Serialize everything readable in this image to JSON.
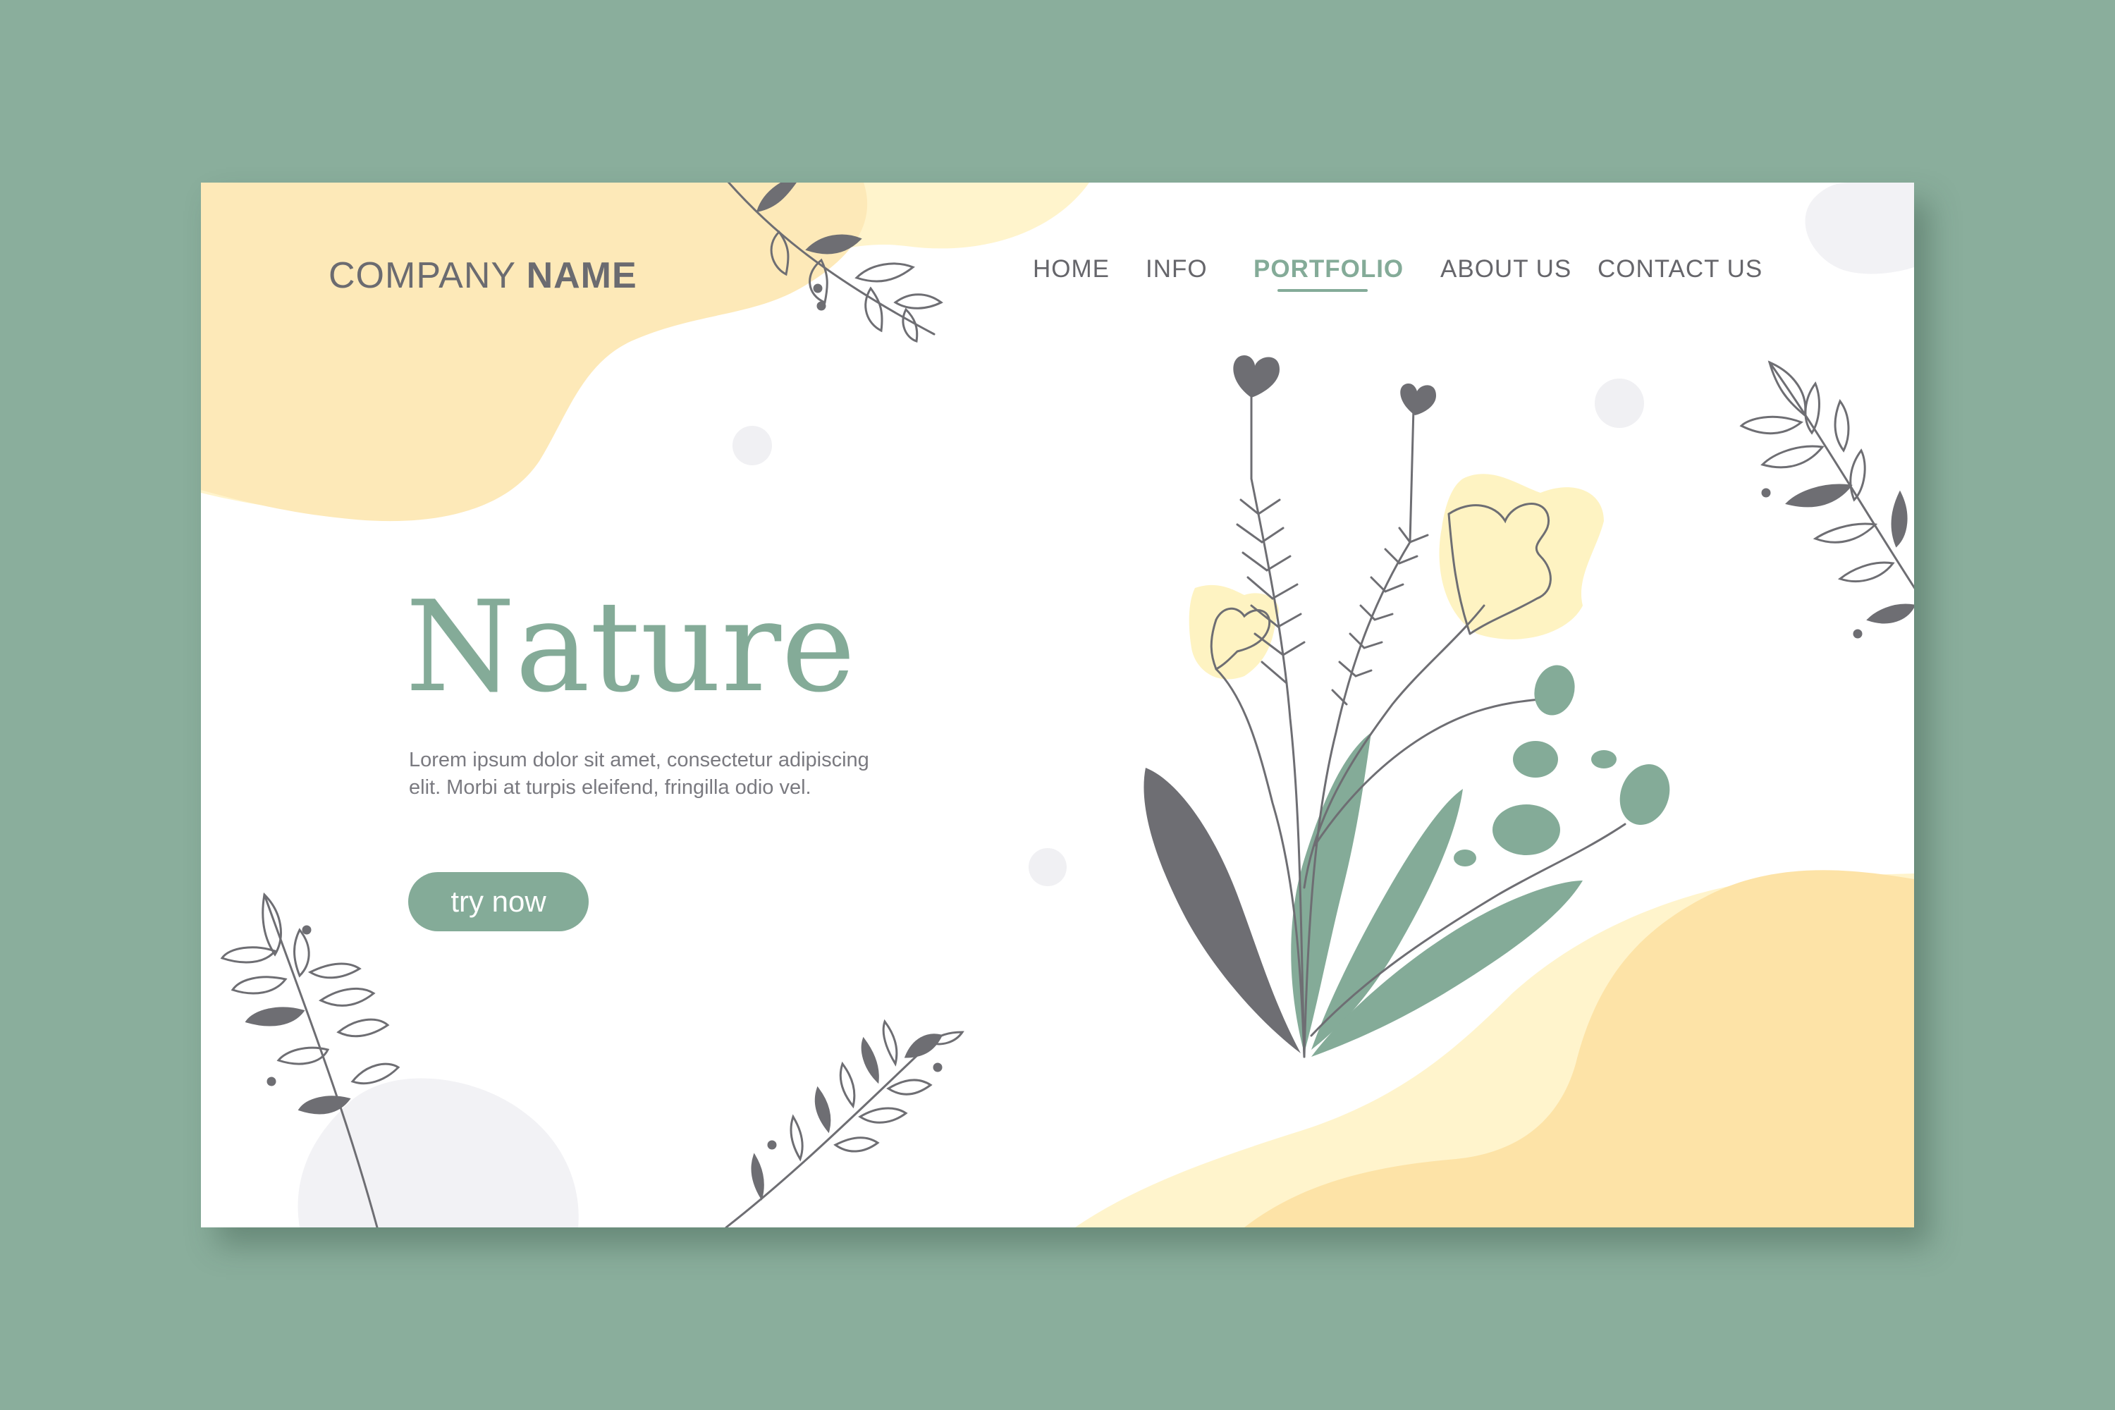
{
  "header": {
    "logo_regular": "COMPANY ",
    "logo_bold": "NAME"
  },
  "nav": {
    "items": [
      "HOME",
      "INFO",
      "PORTFOLIO",
      "ABOUT US",
      "CONTACT US"
    ],
    "active": "PORTFOLIO"
  },
  "hero": {
    "title": "Nature",
    "text": "Lorem ipsum dolor sit amet, consectetur adipiscing elit. Morbi at turpis eleifend, fringilla odio vel.",
    "cta_label": "try now"
  },
  "colors": {
    "backdrop": "#8aae9c",
    "accent_green": "#84ab98",
    "dark_gray": "#6e6e73",
    "pale_yellow": "#fff4cc",
    "peach": "#fde3a7",
    "light_gray": "#f0f0f3"
  },
  "icons": [
    "leaf-branch-icon",
    "flower-bouquet-icon"
  ]
}
